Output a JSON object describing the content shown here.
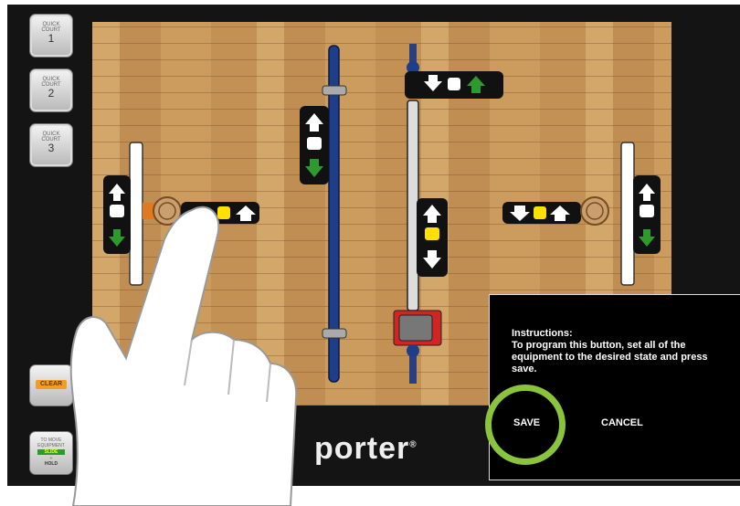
{
  "quick_courts": [
    {
      "top": "QUICK\nCOURT",
      "num": "1"
    },
    {
      "top": "QUICK\nCOURT",
      "num": "2"
    },
    {
      "top": "QUICK\nCOURT",
      "num": "3"
    }
  ],
  "clear_label": "CLEAR",
  "move_hint": {
    "line1": "TO MOVE",
    "line2": "EQUIPMENT",
    "slide": "SLIDE",
    "plus": "+",
    "hold": "HOLD"
  },
  "logo": "porter",
  "logo_mark": "®",
  "dialog": {
    "heading": "Instructions:",
    "body": "To program this button, set all of the equipment to the desired state and press save.",
    "save_label": "SAVE",
    "cancel_label": "CANCEL"
  },
  "colors": {
    "highlight_ring": "#8ac43c",
    "up_arrow": "#2e9a2e",
    "yellow_state": "#ffe000",
    "clear_button": "#f0a020"
  },
  "icons": [
    "hand-pointer-icon",
    "basket-hoop-icon",
    "arrow-up-icon",
    "arrow-down-icon",
    "state-square-icon"
  ]
}
